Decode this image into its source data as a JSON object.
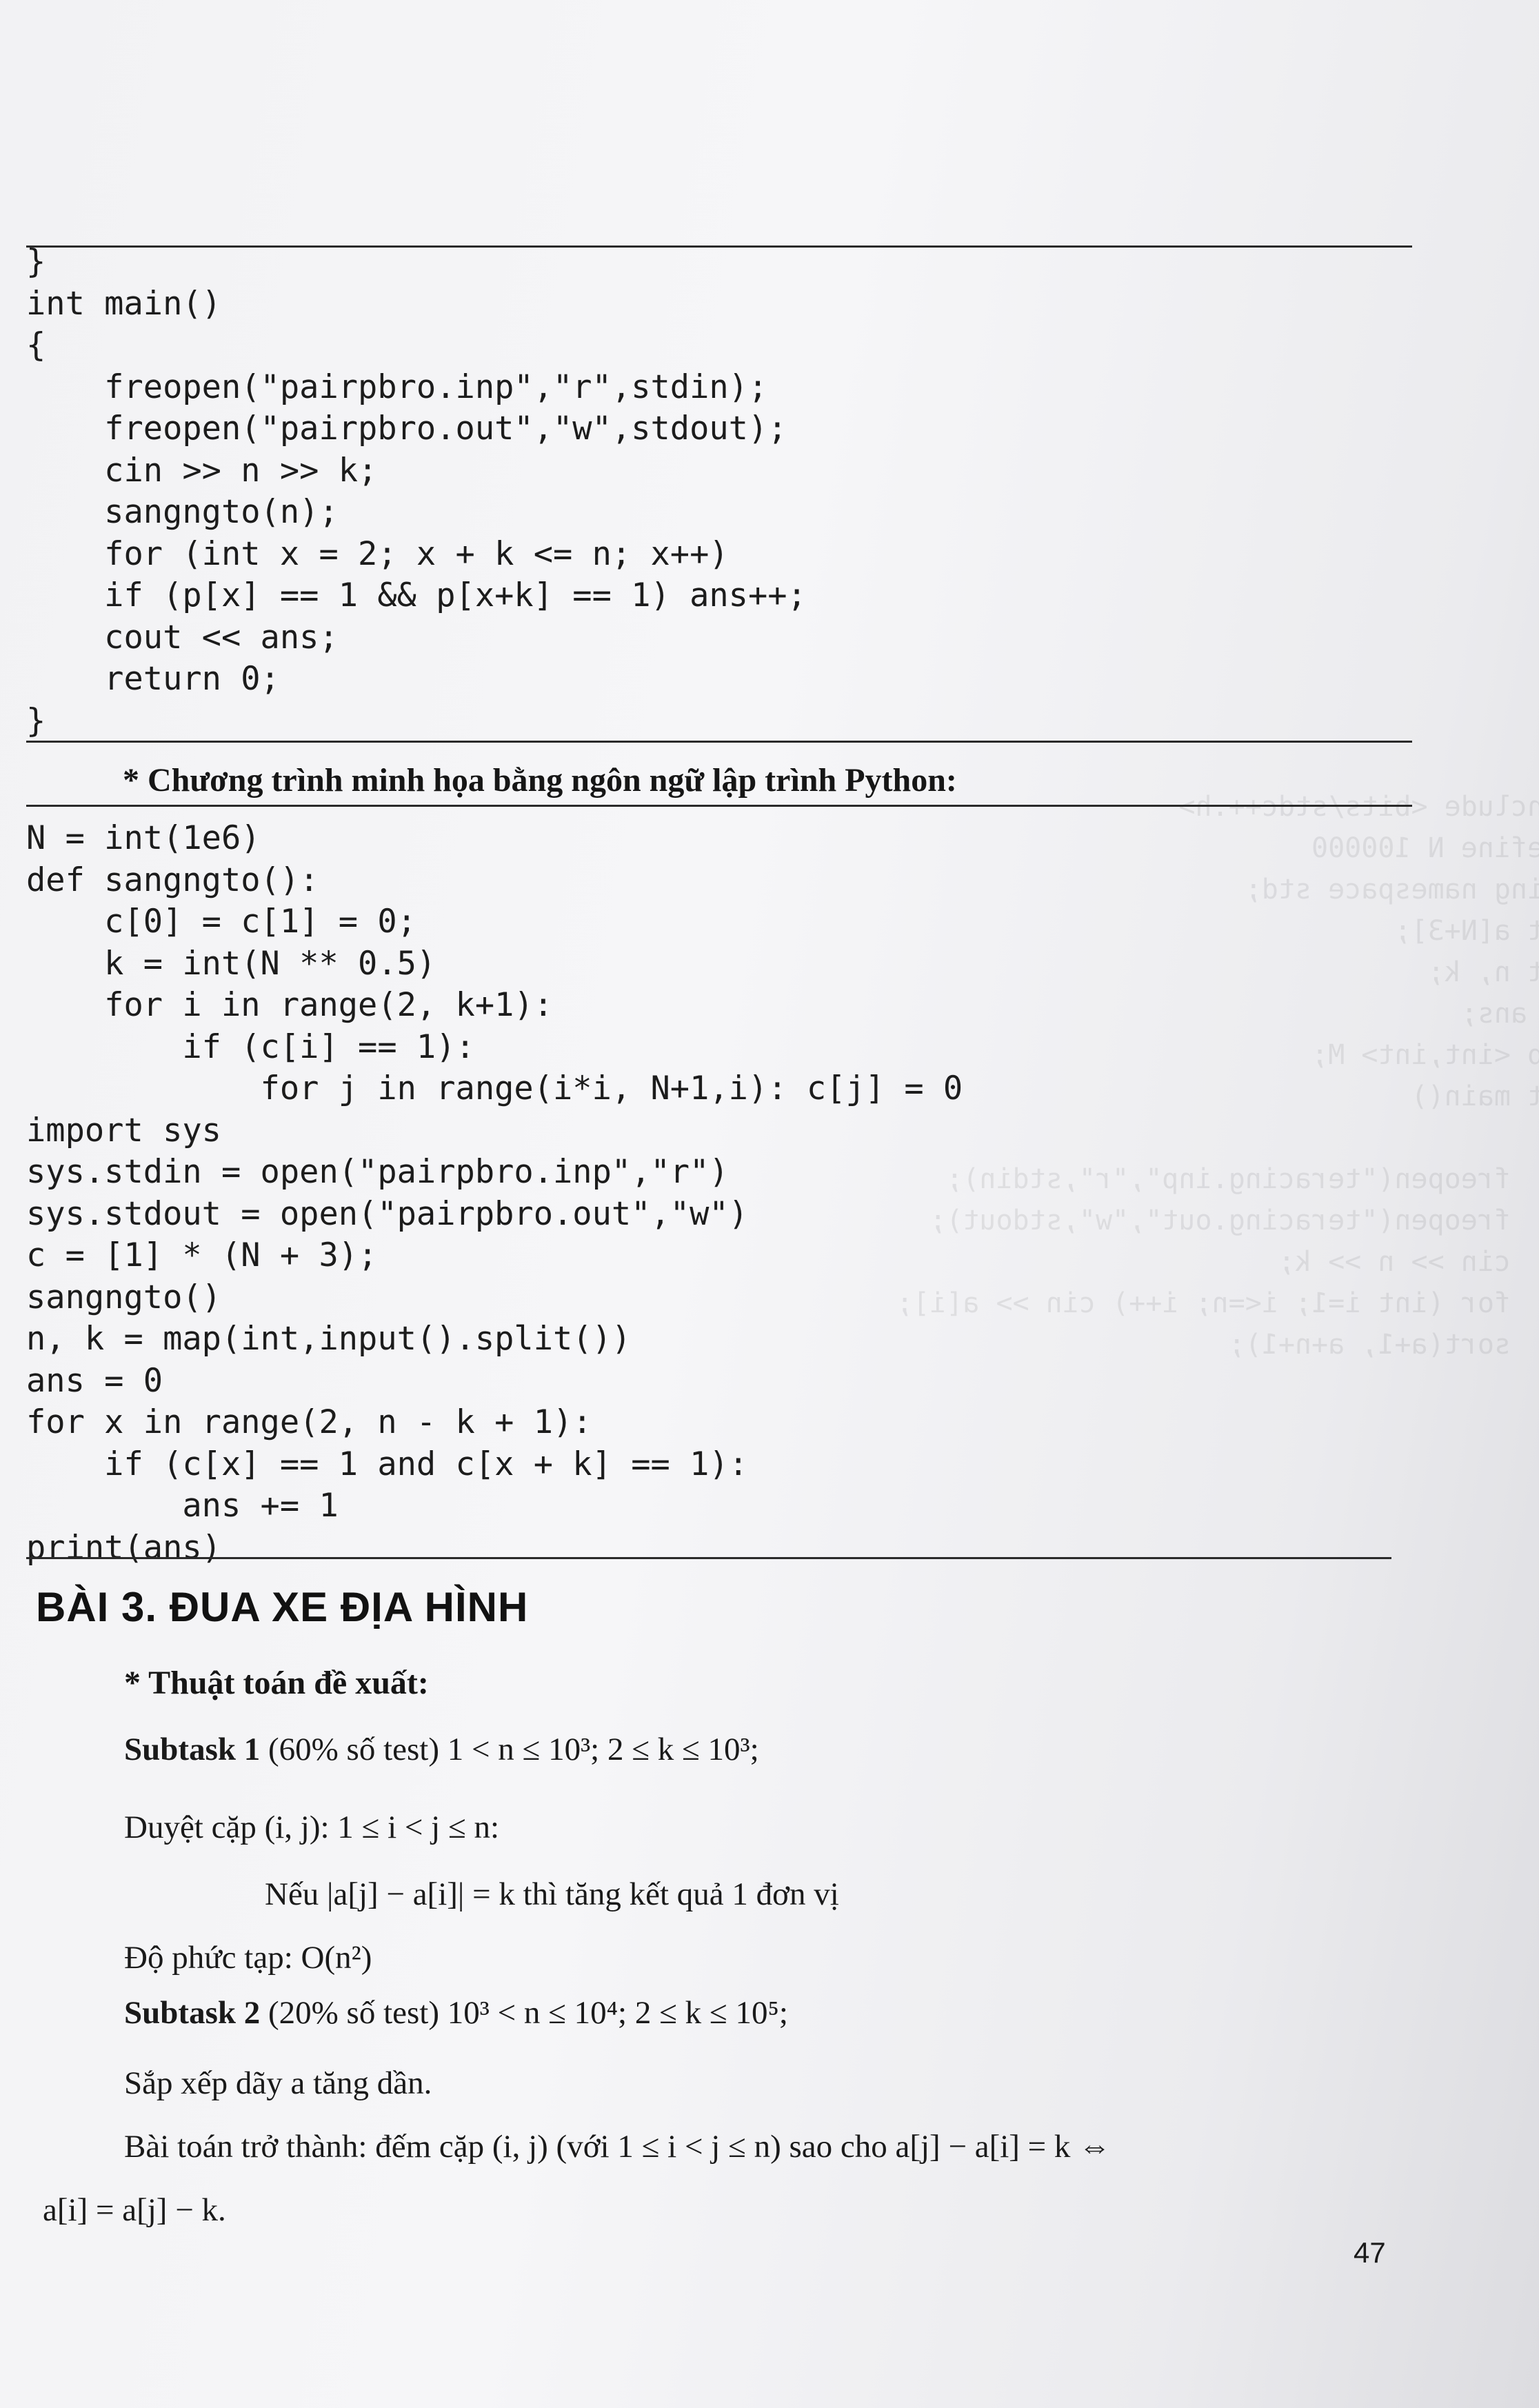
{
  "cpp_code": [
    "}",
    "int main()",
    "{",
    "    freopen(\"pairpbro.inp\",\"r\",stdin);",
    "    freopen(\"pairpbro.out\",\"w\",stdout);",
    "    cin >> n >> k;",
    "    sangngto(n);",
    "    for (int x = 2; x + k <= n; x++)",
    "    if (p[x] == 1 && p[x+k] == 1) ans++;",
    "    cout << ans;",
    "    return 0;",
    "}"
  ],
  "python_heading": "* Chương trình minh họa bằng ngôn ngữ lập trình Python:",
  "python_code": [
    "N = int(1e6)",
    "def sangngto():",
    "    c[0] = c[1] = 0;",
    "    k = int(N ** 0.5)",
    "    for i in range(2, k+1):",
    "        if (c[i] == 1):",
    "            for j in range(i*i, N+1,i): c[j] = 0",
    "import sys",
    "sys.stdin = open(\"pairpbro.inp\",\"r\")",
    "sys.stdout = open(\"pairpbro.out\",\"w\")",
    "c = [1] * (N + 3);",
    "sangngto()",
    "n, k = map(int,input().split())",
    "ans = 0",
    "for x in range(2, n - k + 1):",
    "    if (c[x] == 1 and c[x + k] == 1):",
    "        ans += 1",
    "print(ans)"
  ],
  "section_title": "BÀI 3. ĐUA XE ĐỊA HÌNH",
  "algorithm_heading": "* Thuật toán đề xuất:",
  "subtask1": {
    "label": "Subtask 1",
    "text": " (60% số test) 1 < n ≤ 10³; 2 ≤ k ≤ 10³;"
  },
  "pair_loop": "Duyệt cặp (i, j): 1 ≤ i < j ≤ n:",
  "condition": "Nếu |a[j] − a[i]| = k thì tăng kết quả 1 đơn vị",
  "complexity": "Độ phức tạp: O(n²)",
  "subtask2": {
    "label": "Subtask 2",
    "text": " (20% số test) 10³ < n ≤ 10⁴; 2 ≤ k ≤ 10⁵;"
  },
  "sort_line": "Sắp xếp dãy a tăng dần.",
  "problem_line": "Bài toán trở thành: đếm cặp (i, j) (với 1 ≤ i < j ≤ n) sao cho a[j] − a[i] = k ⇔",
  "problem_cont": "a[i] = a[j] − k.",
  "page_number": "47"
}
